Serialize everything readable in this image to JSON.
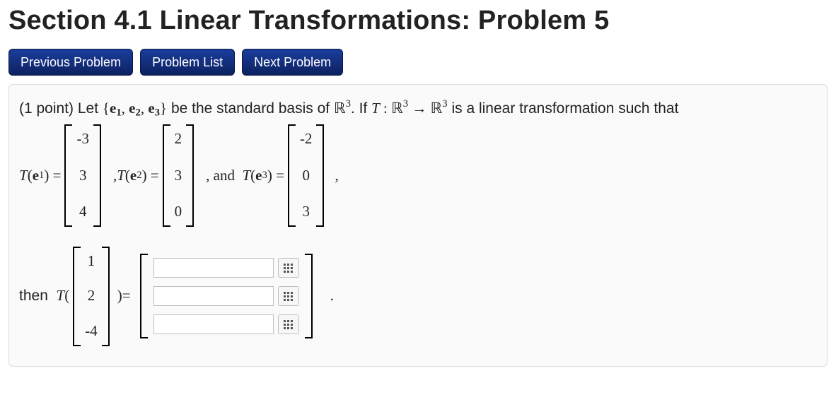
{
  "title": "Section 4.1 Linear Transformations: Problem 5",
  "nav": {
    "prev": "Previous Problem",
    "list": "Problem List",
    "next": "Next Problem"
  },
  "problem": {
    "points_prefix": "(1 point) Let ",
    "basis_open": "{",
    "e1": "e",
    "e1_sub": "1",
    "e2": "e",
    "e2_sub": "2",
    "e3": "e",
    "e3_sub": "3",
    "basis_close": "}",
    "mid1": " be the standard basis of ",
    "R": "ℝ",
    "R_sup": "3",
    "mid2": ". If ",
    "T": "T",
    "colon": " : ",
    "arrow": " → ",
    "mid3": " is a linear transformation such that"
  },
  "eq": {
    "Te1_label_T": "T",
    "Te1_label_open": "(",
    "Te1_label_e": "e",
    "Te1_label_sub": "1",
    "Te1_label_close": ") =",
    "Te2_pre": ", ",
    "Te2_label_T": "T",
    "Te2_label_open": "(",
    "Te2_label_e": "e",
    "Te2_label_sub": "2",
    "Te2_label_close": ") =",
    "Te3_pre": ", and  ",
    "Te3_label_T": "T",
    "Te3_label_open": "(",
    "Te3_label_e": "e",
    "Te3_label_sub": "3",
    "Te3_label_close": ") =",
    "v1": [
      "-3",
      "3",
      "4"
    ],
    "v2": [
      "2",
      "3",
      "0"
    ],
    "v3": [
      "-2",
      "0",
      "3"
    ],
    "tail": ","
  },
  "ans": {
    "then": "then  ",
    "T": "T",
    "open": "(",
    "x": [
      "1",
      "2",
      "-4"
    ],
    "close_eq": ")=",
    "inputs": [
      "",
      "",
      ""
    ],
    "period": "."
  }
}
